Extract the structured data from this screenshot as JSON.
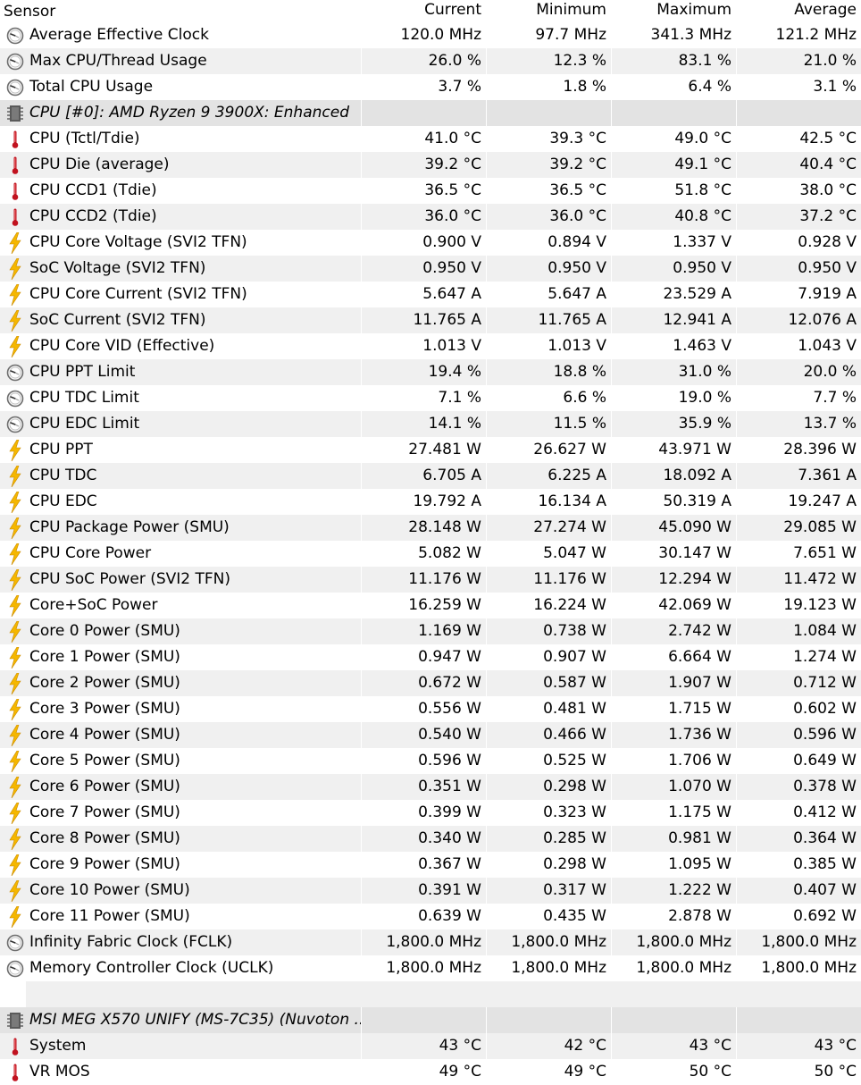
{
  "columns": {
    "sensor": "Sensor",
    "current": "Current",
    "minimum": "Minimum",
    "maximum": "Maximum",
    "average": "Average"
  },
  "icon_colors": {
    "clock": "#6e6e6e",
    "thermometer": "#c1121f",
    "bolt": "#f5b700",
    "chip": "#5a5a5a"
  },
  "rows": [
    {
      "kind": "sensor",
      "icon": "clock-icon",
      "name": "Average Effective Clock",
      "current": "120.0 MHz",
      "minimum": "97.7 MHz",
      "maximum": "341.3 MHz",
      "average": "121.2 MHz"
    },
    {
      "kind": "sensor",
      "icon": "clock-icon",
      "name": "Max CPU/Thread Usage",
      "current": "26.0 %",
      "minimum": "12.3 %",
      "maximum": "83.1 %",
      "average": "21.0 %"
    },
    {
      "kind": "sensor",
      "icon": "clock-icon",
      "name": "Total CPU Usage",
      "current": "3.7 %",
      "minimum": "1.8 %",
      "maximum": "6.4 %",
      "average": "3.1 %"
    },
    {
      "kind": "group",
      "icon": "chip-icon",
      "name": "CPU [#0]: AMD Ryzen 9 3900X: Enhanced"
    },
    {
      "kind": "sensor",
      "icon": "thermometer-icon",
      "name": "CPU (Tctl/Tdie)",
      "current": "41.0 °C",
      "minimum": "39.3 °C",
      "maximum": "49.0 °C",
      "average": "42.5 °C"
    },
    {
      "kind": "sensor",
      "icon": "thermometer-icon",
      "name": "CPU Die (average)",
      "current": "39.2 °C",
      "minimum": "39.2 °C",
      "maximum": "49.1 °C",
      "average": "40.4 °C"
    },
    {
      "kind": "sensor",
      "icon": "thermometer-icon",
      "name": "CPU CCD1 (Tdie)",
      "current": "36.5 °C",
      "minimum": "36.5 °C",
      "maximum": "51.8 °C",
      "average": "38.0 °C"
    },
    {
      "kind": "sensor",
      "icon": "thermometer-icon",
      "name": "CPU CCD2 (Tdie)",
      "current": "36.0 °C",
      "minimum": "36.0 °C",
      "maximum": "40.8 °C",
      "average": "37.2 °C"
    },
    {
      "kind": "sensor",
      "icon": "bolt-icon",
      "name": "CPU Core Voltage (SVI2 TFN)",
      "current": "0.900 V",
      "minimum": "0.894 V",
      "maximum": "1.337 V",
      "average": "0.928 V"
    },
    {
      "kind": "sensor",
      "icon": "bolt-icon",
      "name": "SoC Voltage (SVI2 TFN)",
      "current": "0.950 V",
      "minimum": "0.950 V",
      "maximum": "0.950 V",
      "average": "0.950 V"
    },
    {
      "kind": "sensor",
      "icon": "bolt-icon",
      "name": "CPU Core Current (SVI2 TFN)",
      "current": "5.647 A",
      "minimum": "5.647 A",
      "maximum": "23.529 A",
      "average": "7.919 A"
    },
    {
      "kind": "sensor",
      "icon": "bolt-icon",
      "name": "SoC Current (SVI2 TFN)",
      "current": "11.765 A",
      "minimum": "11.765 A",
      "maximum": "12.941 A",
      "average": "12.076 A"
    },
    {
      "kind": "sensor",
      "icon": "bolt-icon",
      "name": "CPU Core VID (Effective)",
      "current": "1.013 V",
      "minimum": "1.013 V",
      "maximum": "1.463 V",
      "average": "1.043 V"
    },
    {
      "kind": "sensor",
      "icon": "clock-icon",
      "name": "CPU PPT Limit",
      "current": "19.4 %",
      "minimum": "18.8 %",
      "maximum": "31.0 %",
      "average": "20.0 %"
    },
    {
      "kind": "sensor",
      "icon": "clock-icon",
      "name": "CPU TDC Limit",
      "current": "7.1 %",
      "minimum": "6.6 %",
      "maximum": "19.0 %",
      "average": "7.7 %"
    },
    {
      "kind": "sensor",
      "icon": "clock-icon",
      "name": "CPU EDC Limit",
      "current": "14.1 %",
      "minimum": "11.5 %",
      "maximum": "35.9 %",
      "average": "13.7 %"
    },
    {
      "kind": "sensor",
      "icon": "bolt-icon",
      "name": "CPU PPT",
      "current": "27.481 W",
      "minimum": "26.627 W",
      "maximum": "43.971 W",
      "average": "28.396 W"
    },
    {
      "kind": "sensor",
      "icon": "bolt-icon",
      "name": "CPU TDC",
      "current": "6.705 A",
      "minimum": "6.225 A",
      "maximum": "18.092 A",
      "average": "7.361 A"
    },
    {
      "kind": "sensor",
      "icon": "bolt-icon",
      "name": "CPU EDC",
      "current": "19.792 A",
      "minimum": "16.134 A",
      "maximum": "50.319 A",
      "average": "19.247 A"
    },
    {
      "kind": "sensor",
      "icon": "bolt-icon",
      "name": "CPU Package Power (SMU)",
      "current": "28.148 W",
      "minimum": "27.274 W",
      "maximum": "45.090 W",
      "average": "29.085 W"
    },
    {
      "kind": "sensor",
      "icon": "bolt-icon",
      "name": "CPU Core Power",
      "current": "5.082 W",
      "minimum": "5.047 W",
      "maximum": "30.147 W",
      "average": "7.651 W"
    },
    {
      "kind": "sensor",
      "icon": "bolt-icon",
      "name": "CPU SoC Power (SVI2 TFN)",
      "current": "11.176 W",
      "minimum": "11.176 W",
      "maximum": "12.294 W",
      "average": "11.472 W"
    },
    {
      "kind": "sensor",
      "icon": "bolt-icon",
      "name": "Core+SoC Power",
      "current": "16.259 W",
      "minimum": "16.224 W",
      "maximum": "42.069 W",
      "average": "19.123 W"
    },
    {
      "kind": "sensor",
      "icon": "bolt-icon",
      "name": "Core 0 Power (SMU)",
      "current": "1.169 W",
      "minimum": "0.738 W",
      "maximum": "2.742 W",
      "average": "1.084 W"
    },
    {
      "kind": "sensor",
      "icon": "bolt-icon",
      "name": "Core 1 Power (SMU)",
      "current": "0.947 W",
      "minimum": "0.907 W",
      "maximum": "6.664 W",
      "average": "1.274 W"
    },
    {
      "kind": "sensor",
      "icon": "bolt-icon",
      "name": "Core 2 Power (SMU)",
      "current": "0.672 W",
      "minimum": "0.587 W",
      "maximum": "1.907 W",
      "average": "0.712 W"
    },
    {
      "kind": "sensor",
      "icon": "bolt-icon",
      "name": "Core 3 Power (SMU)",
      "current": "0.556 W",
      "minimum": "0.481 W",
      "maximum": "1.715 W",
      "average": "0.602 W"
    },
    {
      "kind": "sensor",
      "icon": "bolt-icon",
      "name": "Core 4 Power (SMU)",
      "current": "0.540 W",
      "minimum": "0.466 W",
      "maximum": "1.736 W",
      "average": "0.596 W"
    },
    {
      "kind": "sensor",
      "icon": "bolt-icon",
      "name": "Core 5 Power (SMU)",
      "current": "0.596 W",
      "minimum": "0.525 W",
      "maximum": "1.706 W",
      "average": "0.649 W"
    },
    {
      "kind": "sensor",
      "icon": "bolt-icon",
      "name": "Core 6 Power (SMU)",
      "current": "0.351 W",
      "minimum": "0.298 W",
      "maximum": "1.070 W",
      "average": "0.378 W"
    },
    {
      "kind": "sensor",
      "icon": "bolt-icon",
      "name": "Core 7 Power (SMU)",
      "current": "0.399 W",
      "minimum": "0.323 W",
      "maximum": "1.175 W",
      "average": "0.412 W"
    },
    {
      "kind": "sensor",
      "icon": "bolt-icon",
      "name": "Core 8 Power (SMU)",
      "current": "0.340 W",
      "minimum": "0.285 W",
      "maximum": "0.981 W",
      "average": "0.364 W"
    },
    {
      "kind": "sensor",
      "icon": "bolt-icon",
      "name": "Core 9 Power (SMU)",
      "current": "0.367 W",
      "minimum": "0.298 W",
      "maximum": "1.095 W",
      "average": "0.385 W"
    },
    {
      "kind": "sensor",
      "icon": "bolt-icon",
      "name": "Core 10 Power (SMU)",
      "current": "0.391 W",
      "minimum": "0.317 W",
      "maximum": "1.222 W",
      "average": "0.407 W"
    },
    {
      "kind": "sensor",
      "icon": "bolt-icon",
      "name": "Core 11 Power (SMU)",
      "current": "0.639 W",
      "minimum": "0.435 W",
      "maximum": "2.878 W",
      "average": "0.692 W"
    },
    {
      "kind": "sensor",
      "icon": "clock-icon",
      "name": "Infinity Fabric Clock (FCLK)",
      "current": "1,800.0 MHz",
      "minimum": "1,800.0 MHz",
      "maximum": "1,800.0 MHz",
      "average": "1,800.0 MHz"
    },
    {
      "kind": "sensor",
      "icon": "clock-icon",
      "name": "Memory Controller Clock (UCLK)",
      "current": "1,800.0 MHz",
      "minimum": "1,800.0 MHz",
      "maximum": "1,800.0 MHz",
      "average": "1,800.0 MHz"
    },
    {
      "kind": "spacer"
    },
    {
      "kind": "group",
      "icon": "chip-icon",
      "name": "MSI MEG X570 UNIFY (MS-7C35) (Nuvoton ..."
    },
    {
      "kind": "sensor",
      "icon": "thermometer-icon",
      "name": "System",
      "current": "43 °C",
      "minimum": "42 °C",
      "maximum": "43 °C",
      "average": "43 °C"
    },
    {
      "kind": "sensor",
      "icon": "thermometer-icon",
      "name": "VR MOS",
      "current": "49 °C",
      "minimum": "49 °C",
      "maximum": "50 °C",
      "average": "50 °C"
    }
  ]
}
